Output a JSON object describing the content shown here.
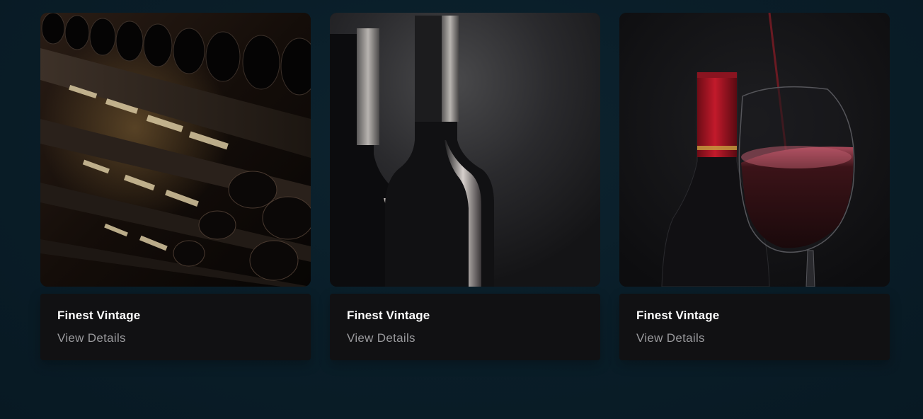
{
  "cards": [
    {
      "title": "Finest Vintage",
      "link_label": "View Details",
      "image": "wine-cellar-rack-photo"
    },
    {
      "title": "Finest Vintage",
      "link_label": "View Details",
      "image": "two-wine-bottles-photo"
    },
    {
      "title": "Finest Vintage",
      "link_label": "View Details",
      "image": "red-wine-pour-photo"
    }
  ]
}
